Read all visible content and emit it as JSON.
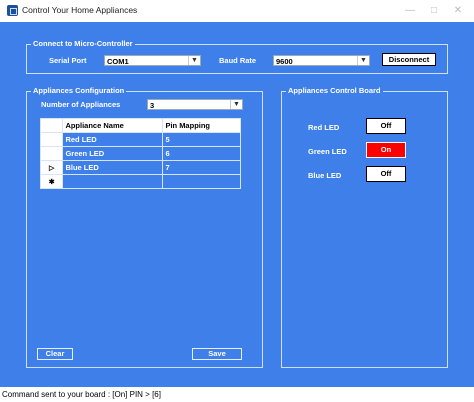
{
  "window": {
    "title": "Control Your Home Appliances"
  },
  "connect": {
    "legend": "Connect to Micro-Controller",
    "serial_port_label": "Serial Port",
    "serial_port_value": "COM1",
    "baud_rate_label": "Baud Rate",
    "baud_rate_value": "9600",
    "disconnect_label": "Disconnect"
  },
  "config": {
    "legend": "Appliances Configuration",
    "number_label": "Number of Appliances",
    "number_value": "3",
    "columns": [
      "Appliance Name",
      "Pin Mapping"
    ],
    "rows": [
      {
        "name": "Red LED",
        "pin": "5"
      },
      {
        "name": "Green LED",
        "pin": "6"
      },
      {
        "name": "Blue LED",
        "pin": "7"
      }
    ],
    "current_row_marker": "▷",
    "new_row_marker": "✱",
    "clear_label": "Clear",
    "save_label": "Save"
  },
  "board": {
    "legend": "Appliances Control Board",
    "items": [
      {
        "label": "Red LED",
        "state": "Off"
      },
      {
        "label": "Green LED",
        "state": "On"
      },
      {
        "label": "Blue LED",
        "state": "Off"
      }
    ]
  },
  "status": {
    "text": "Command sent to your board : [On] PIN > [6]"
  },
  "colors": {
    "background": "#3f7fe9",
    "on": "#ff0000",
    "off": "#ffffff"
  }
}
